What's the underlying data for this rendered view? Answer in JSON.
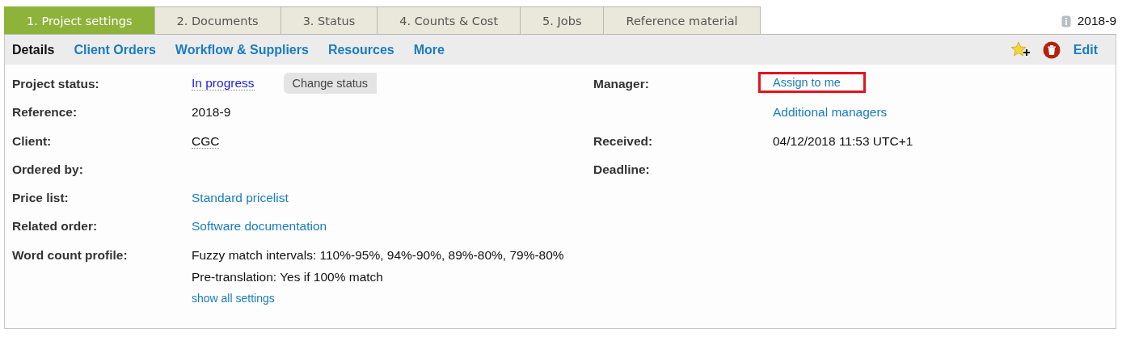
{
  "tabs": [
    {
      "label": "1. Project settings",
      "selected": true
    },
    {
      "label": "2. Documents",
      "selected": false
    },
    {
      "label": "3. Status",
      "selected": false
    },
    {
      "label": "4. Counts & Cost",
      "selected": false
    },
    {
      "label": "5. Jobs",
      "selected": false
    },
    {
      "label": "Reference material",
      "selected": false
    }
  ],
  "project_id": "2018-9",
  "subnav": [
    {
      "label": "Details",
      "selected": true
    },
    {
      "label": "Client Orders",
      "selected": false
    },
    {
      "label": "Workflow & Suppliers",
      "selected": false
    },
    {
      "label": "Resources",
      "selected": false
    },
    {
      "label": "More",
      "selected": false
    }
  ],
  "edit_link": "Edit",
  "left_fields": [
    {
      "label": "Project status:",
      "values": [
        {
          "kind": "status",
          "text": "In progress",
          "button": "Change status"
        }
      ]
    },
    {
      "label": "Reference:",
      "values": [
        {
          "kind": "text",
          "text": "2018-9"
        }
      ]
    },
    {
      "label": "Client:",
      "values": [
        {
          "kind": "dotted",
          "text": "CGC"
        }
      ]
    },
    {
      "label": "Ordered by:"
    },
    {
      "label": "Price list:",
      "values": [
        {
          "kind": "link",
          "text": "Standard pricelist"
        }
      ]
    },
    {
      "label": "Related order:",
      "values": [
        {
          "kind": "link",
          "text": "Software documentation"
        }
      ]
    },
    {
      "label": "Word count profile:",
      "values": [
        {
          "kind": "text",
          "text": "Fuzzy match intervals: 110%-95%, 94%-90%, 89%-80%, 79%-80%"
        },
        {
          "kind": "text",
          "text": "Pre-translation: Yes if 100% match"
        },
        {
          "kind": "small_link",
          "text": "show all settings"
        }
      ]
    }
  ],
  "right_fields": [
    {
      "label": "Manager:",
      "values": [
        {
          "kind": "highlighted_link",
          "text": "Assign to me"
        }
      ]
    },
    {
      "values": [
        {
          "kind": "link",
          "text": "Additional managers"
        }
      ]
    },
    {
      "label": "Received:",
      "values": [
        {
          "kind": "text",
          "text": "04/12/2018 11:53 UTC+1"
        }
      ]
    },
    {
      "label": "Deadline:"
    }
  ]
}
